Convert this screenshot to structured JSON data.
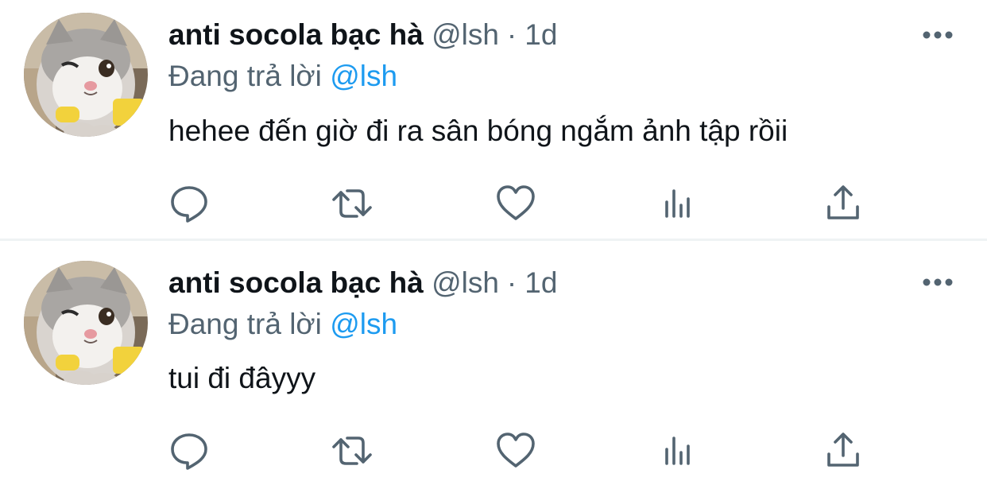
{
  "tweets": [
    {
      "display_name": "anti socola bạc hà",
      "handle": "@lsh",
      "separator": "·",
      "timestamp": "1d",
      "replying_to_label": "Đang trả lời",
      "replying_to_handle": "@lsh",
      "text": "hehee đến giờ đi ra sân bóng ngắm ảnh tập rồii",
      "avatar": "cat-avatar",
      "actions": [
        "reply-icon",
        "retweet-icon",
        "like-icon",
        "views-icon",
        "share-icon"
      ]
    },
    {
      "display_name": "anti socola bạc hà",
      "handle": "@lsh",
      "separator": "·",
      "timestamp": "1d",
      "replying_to_label": "Đang trả lời",
      "replying_to_handle": "@lsh",
      "text": "tui đi đâyyy",
      "avatar": "cat-avatar",
      "actions": [
        "reply-icon",
        "retweet-icon",
        "like-icon",
        "views-icon",
        "share-icon"
      ]
    }
  ],
  "colors": {
    "primary_text": "#0f1419",
    "secondary_text": "#536471",
    "link": "#1d9bf0",
    "divider": "#eff3f4"
  }
}
